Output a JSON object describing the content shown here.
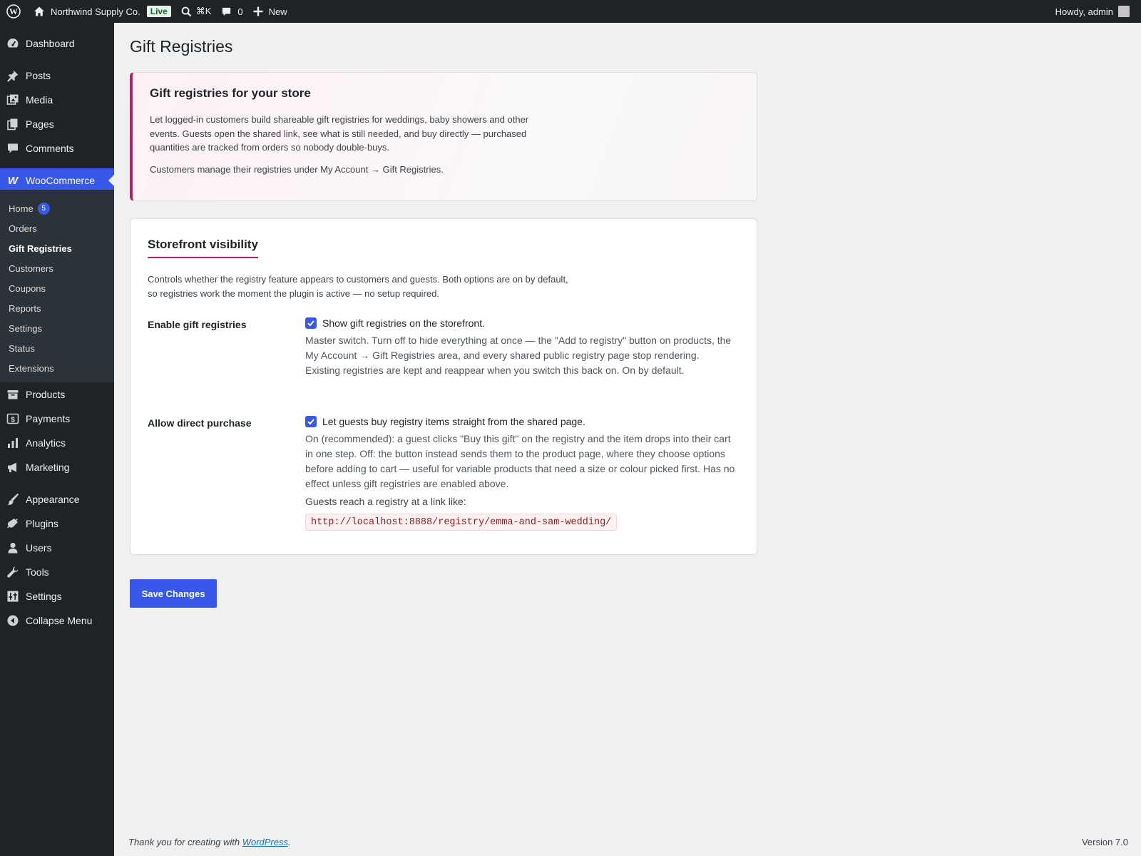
{
  "adminbar": {
    "site_name": "Northwind Supply Co.",
    "live_badge": "Live",
    "search_shortcut": "⌘K",
    "comments_count": "0",
    "new_label": "New",
    "howdy": "Howdy, admin"
  },
  "sidebar": {
    "items": [
      {
        "label": "Dashboard",
        "icon": "dashboard-icon"
      },
      {
        "label": "Posts",
        "icon": "pushpin-icon"
      },
      {
        "label": "Media",
        "icon": "media-icon"
      },
      {
        "label": "Pages",
        "icon": "pages-icon"
      },
      {
        "label": "Comments",
        "icon": "comment-icon"
      },
      {
        "label": "WooCommerce",
        "icon": "woocommerce-icon"
      },
      {
        "label": "Products",
        "icon": "archive-icon"
      },
      {
        "label": "Payments",
        "icon": "payments-icon"
      },
      {
        "label": "Analytics",
        "icon": "bar-chart-icon"
      },
      {
        "label": "Marketing",
        "icon": "megaphone-icon"
      },
      {
        "label": "Appearance",
        "icon": "paintbrush-icon"
      },
      {
        "label": "Plugins",
        "icon": "plugin-icon"
      },
      {
        "label": "Users",
        "icon": "user-icon"
      },
      {
        "label": "Tools",
        "icon": "wrench-icon"
      },
      {
        "label": "Settings",
        "icon": "settings-sliders-icon"
      },
      {
        "label": "Collapse Menu",
        "icon": "collapse-icon"
      }
    ],
    "submenu": [
      {
        "label": "Home",
        "badge": "5"
      },
      {
        "label": "Orders"
      },
      {
        "label": "Gift Registries"
      },
      {
        "label": "Customers"
      },
      {
        "label": "Coupons"
      },
      {
        "label": "Reports"
      },
      {
        "label": "Settings"
      },
      {
        "label": "Status"
      },
      {
        "label": "Extensions"
      }
    ]
  },
  "page": {
    "title": "Gift Registries"
  },
  "intro": {
    "title": "Gift registries for your store",
    "text": "Let logged-in customers build shareable gift registries for weddings, baby showers and other events. Guests open the shared link, see what is still needed, and buy directly — purchased quantities are tracked from orders so nobody double-buys.",
    "sub": "Customers manage their registries under My Account → Gift Registries."
  },
  "settings": {
    "section_title": "Storefront visibility",
    "section_desc": "Controls whether the registry feature appears to customers and guests. Both options are on by default, so registries work the moment the plugin is active — no setup required.",
    "enable": {
      "label": "Enable gift registries",
      "checkbox_label": "Show gift registries on the storefront.",
      "checked": true,
      "help": "Master switch. Turn off to hide everything at once — the \"Add to registry\" button on products, the My Account → Gift Registries area, and every shared public registry page stop rendering. Existing registries are kept and reappear when you switch this back on. On by default."
    },
    "direct": {
      "label": "Allow direct purchase",
      "checkbox_label": "Let guests buy registry items straight from the shared page.",
      "checked": true,
      "help": "On (recommended): a guest clicks \"Buy this gift\" on the registry and the item drops into their cart in one step. Off: the button instead sends them to the product page, where they choose options before adding to cart — useful for variable products that need a size or colour picked first. Has no effect unless gift registries are enabled above.",
      "link_caption": "Guests reach a registry at a link like:",
      "example_url": "http://localhost:8888/registry/emma-and-sam-wedding/"
    }
  },
  "save_label": "Save Changes",
  "footer": {
    "thanks_prefix": "Thank you for creating with ",
    "thanks_link": "WordPress",
    "thanks_suffix": ".",
    "version": "Version 7.0"
  },
  "colors": {
    "accent": "#3858e9",
    "brand": "#b0255f",
    "sidebar_bg": "#1d2327",
    "submenu_bg": "#2c3338"
  }
}
